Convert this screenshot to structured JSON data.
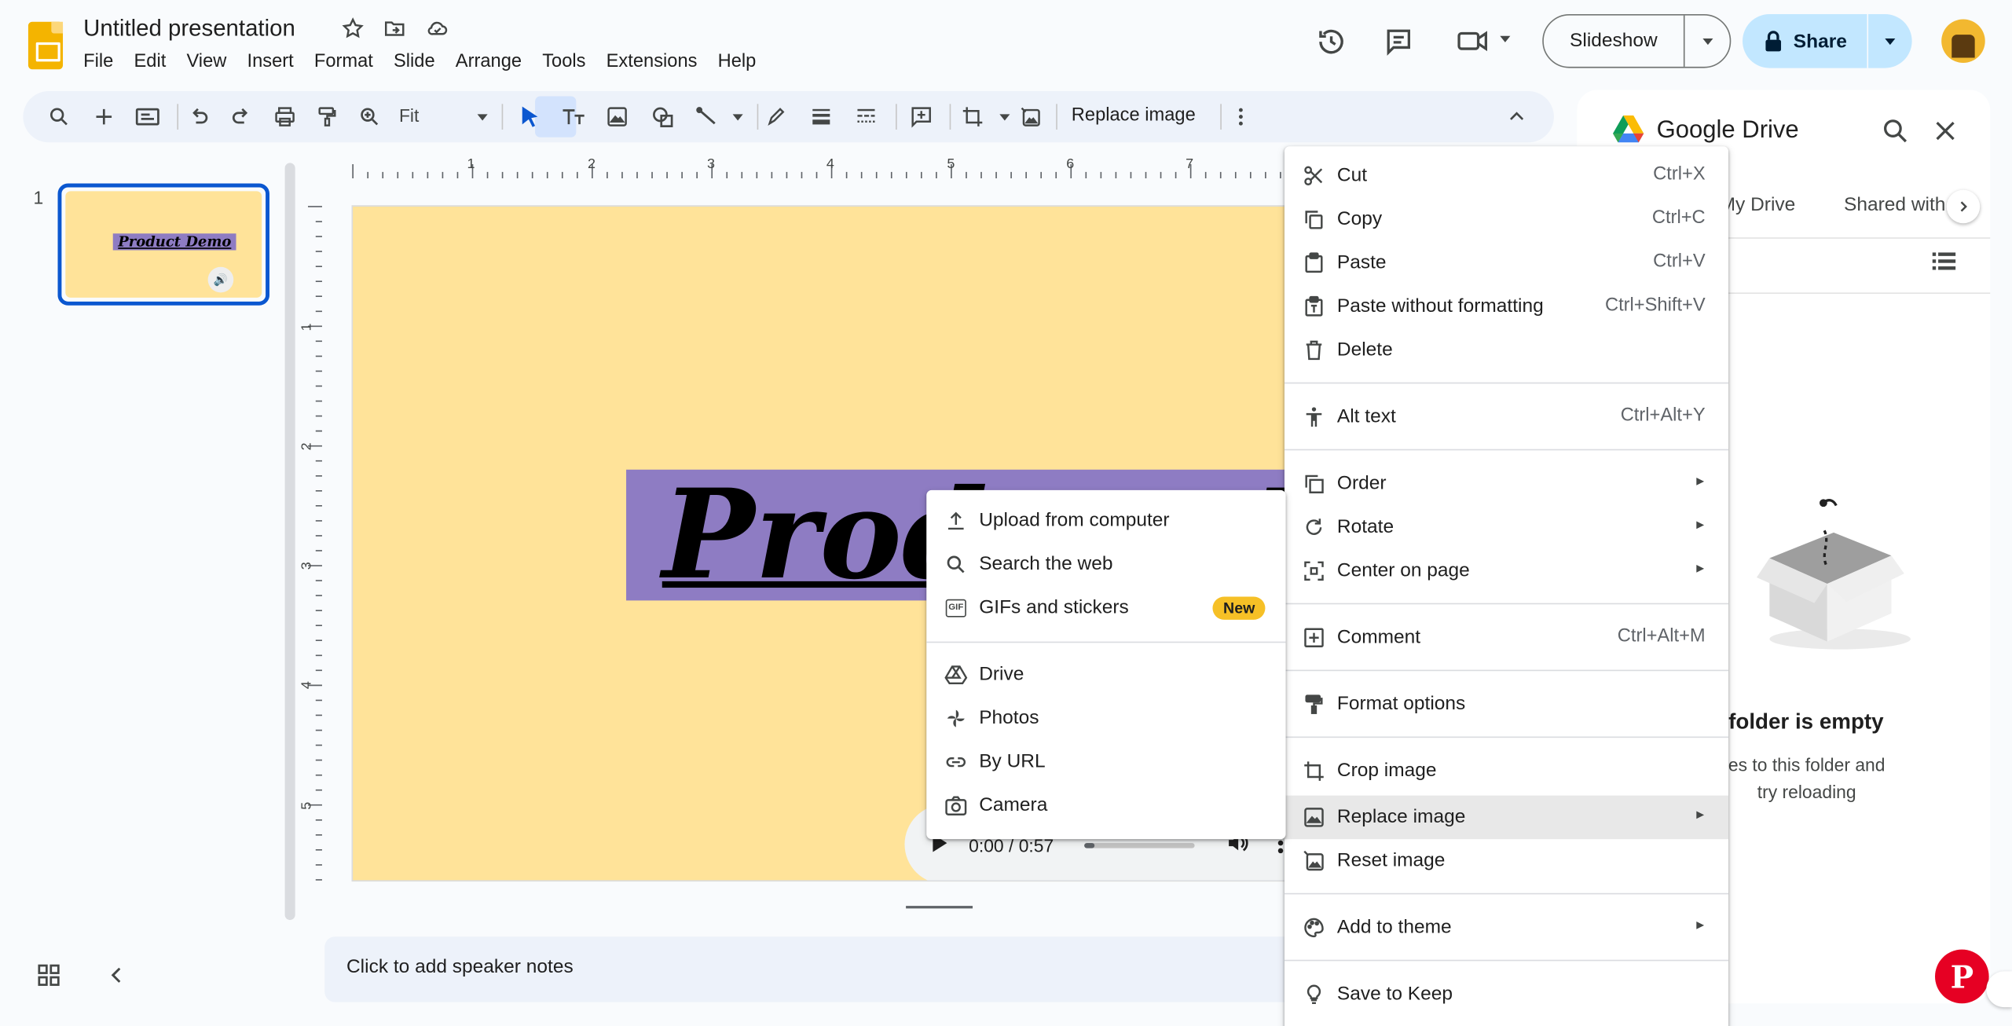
{
  "app": {
    "document_title": "Untitled presentation",
    "menu": [
      "File",
      "Edit",
      "View",
      "Insert",
      "Format",
      "Slide",
      "Arrange",
      "Tools",
      "Extensions",
      "Help"
    ],
    "slideshow_label": "Slideshow",
    "share_label": "Share"
  },
  "toolbar": {
    "zoom_label": "Fit",
    "replace_image_label": "Replace image"
  },
  "filmstrip": {
    "slide_number": "1",
    "thumb_title": "Product Demo"
  },
  "rulers": {
    "horizontal": [
      "1",
      "2",
      "3",
      "4",
      "5",
      "6",
      "7"
    ],
    "vertical": [
      "1",
      "2",
      "3",
      "4",
      "5"
    ]
  },
  "slide": {
    "title_text": "Product Demo",
    "audio_time": "0:00 / 0:57",
    "audio_progress": 0.03
  },
  "notes": {
    "placeholder": "Click to add speaker notes"
  },
  "side_panel": {
    "title": "Google Drive",
    "tabs": [
      "My Drive",
      "Shared with me"
    ],
    "empty_title": "folder is empty",
    "empty_line1": "es to this folder and",
    "empty_line2": "try reloading"
  },
  "context_menu": {
    "cut": {
      "label": "Cut",
      "shortcut": "Ctrl+X"
    },
    "copy": {
      "label": "Copy",
      "shortcut": "Ctrl+C"
    },
    "paste": {
      "label": "Paste",
      "shortcut": "Ctrl+V"
    },
    "paste_plain": {
      "label": "Paste without formatting",
      "shortcut": "Ctrl+Shift+V"
    },
    "delete": {
      "label": "Delete"
    },
    "alt_text": {
      "label": "Alt text",
      "shortcut": "Ctrl+Alt+Y"
    },
    "order": {
      "label": "Order"
    },
    "rotate": {
      "label": "Rotate"
    },
    "center": {
      "label": "Center on page"
    },
    "comment": {
      "label": "Comment",
      "shortcut": "Ctrl+Alt+M"
    },
    "format_options": {
      "label": "Format options"
    },
    "crop_image": {
      "label": "Crop image"
    },
    "replace_image": {
      "label": "Replace image"
    },
    "reset_image": {
      "label": "Reset image"
    },
    "add_to_theme": {
      "label": "Add to theme"
    },
    "save_to_keep": {
      "label": "Save to Keep"
    }
  },
  "submenu": {
    "upload": "Upload from computer",
    "search_web": "Search the web",
    "gifs": "GIFs and stickers",
    "gifs_badge": "New",
    "gif_icon_text": "GIF",
    "drive": "Drive",
    "photos": "Photos",
    "by_url": "By URL",
    "camera": "Camera"
  },
  "colors": {
    "slide_background": "#ffe399",
    "title_box": "#8e7cc3",
    "accent": "#0b57d0",
    "share_button": "#c2e7ff"
  }
}
